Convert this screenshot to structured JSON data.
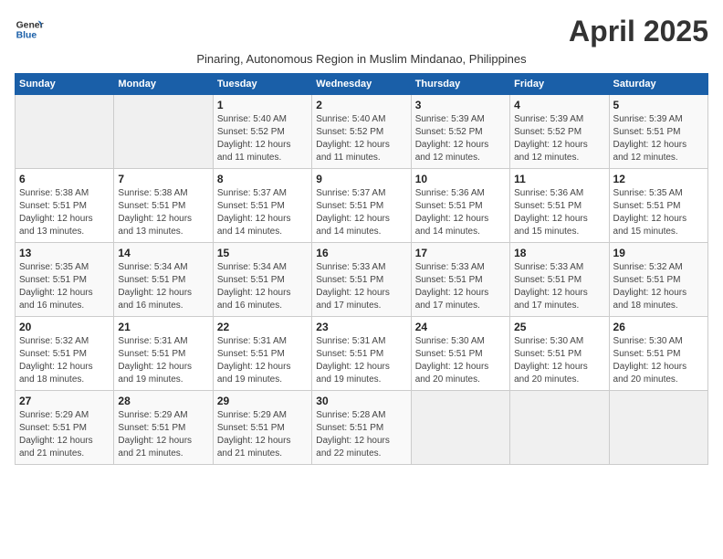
{
  "header": {
    "logo_line1": "General",
    "logo_line2": "Blue",
    "title": "April 2025",
    "subtitle": "Pinaring, Autonomous Region in Muslim Mindanao, Philippines"
  },
  "days_of_week": [
    "Sunday",
    "Monday",
    "Tuesday",
    "Wednesday",
    "Thursday",
    "Friday",
    "Saturday"
  ],
  "weeks": [
    [
      {
        "day": "",
        "info": ""
      },
      {
        "day": "",
        "info": ""
      },
      {
        "day": "1",
        "info": "Sunrise: 5:40 AM\nSunset: 5:52 PM\nDaylight: 12 hours and 11 minutes."
      },
      {
        "day": "2",
        "info": "Sunrise: 5:40 AM\nSunset: 5:52 PM\nDaylight: 12 hours and 11 minutes."
      },
      {
        "day": "3",
        "info": "Sunrise: 5:39 AM\nSunset: 5:52 PM\nDaylight: 12 hours and 12 minutes."
      },
      {
        "day": "4",
        "info": "Sunrise: 5:39 AM\nSunset: 5:52 PM\nDaylight: 12 hours and 12 minutes."
      },
      {
        "day": "5",
        "info": "Sunrise: 5:39 AM\nSunset: 5:51 PM\nDaylight: 12 hours and 12 minutes."
      }
    ],
    [
      {
        "day": "6",
        "info": "Sunrise: 5:38 AM\nSunset: 5:51 PM\nDaylight: 12 hours and 13 minutes."
      },
      {
        "day": "7",
        "info": "Sunrise: 5:38 AM\nSunset: 5:51 PM\nDaylight: 12 hours and 13 minutes."
      },
      {
        "day": "8",
        "info": "Sunrise: 5:37 AM\nSunset: 5:51 PM\nDaylight: 12 hours and 14 minutes."
      },
      {
        "day": "9",
        "info": "Sunrise: 5:37 AM\nSunset: 5:51 PM\nDaylight: 12 hours and 14 minutes."
      },
      {
        "day": "10",
        "info": "Sunrise: 5:36 AM\nSunset: 5:51 PM\nDaylight: 12 hours and 14 minutes."
      },
      {
        "day": "11",
        "info": "Sunrise: 5:36 AM\nSunset: 5:51 PM\nDaylight: 12 hours and 15 minutes."
      },
      {
        "day": "12",
        "info": "Sunrise: 5:35 AM\nSunset: 5:51 PM\nDaylight: 12 hours and 15 minutes."
      }
    ],
    [
      {
        "day": "13",
        "info": "Sunrise: 5:35 AM\nSunset: 5:51 PM\nDaylight: 12 hours and 16 minutes."
      },
      {
        "day": "14",
        "info": "Sunrise: 5:34 AM\nSunset: 5:51 PM\nDaylight: 12 hours and 16 minutes."
      },
      {
        "day": "15",
        "info": "Sunrise: 5:34 AM\nSunset: 5:51 PM\nDaylight: 12 hours and 16 minutes."
      },
      {
        "day": "16",
        "info": "Sunrise: 5:33 AM\nSunset: 5:51 PM\nDaylight: 12 hours and 17 minutes."
      },
      {
        "day": "17",
        "info": "Sunrise: 5:33 AM\nSunset: 5:51 PM\nDaylight: 12 hours and 17 minutes."
      },
      {
        "day": "18",
        "info": "Sunrise: 5:33 AM\nSunset: 5:51 PM\nDaylight: 12 hours and 17 minutes."
      },
      {
        "day": "19",
        "info": "Sunrise: 5:32 AM\nSunset: 5:51 PM\nDaylight: 12 hours and 18 minutes."
      }
    ],
    [
      {
        "day": "20",
        "info": "Sunrise: 5:32 AM\nSunset: 5:51 PM\nDaylight: 12 hours and 18 minutes."
      },
      {
        "day": "21",
        "info": "Sunrise: 5:31 AM\nSunset: 5:51 PM\nDaylight: 12 hours and 19 minutes."
      },
      {
        "day": "22",
        "info": "Sunrise: 5:31 AM\nSunset: 5:51 PM\nDaylight: 12 hours and 19 minutes."
      },
      {
        "day": "23",
        "info": "Sunrise: 5:31 AM\nSunset: 5:51 PM\nDaylight: 12 hours and 19 minutes."
      },
      {
        "day": "24",
        "info": "Sunrise: 5:30 AM\nSunset: 5:51 PM\nDaylight: 12 hours and 20 minutes."
      },
      {
        "day": "25",
        "info": "Sunrise: 5:30 AM\nSunset: 5:51 PM\nDaylight: 12 hours and 20 minutes."
      },
      {
        "day": "26",
        "info": "Sunrise: 5:30 AM\nSunset: 5:51 PM\nDaylight: 12 hours and 20 minutes."
      }
    ],
    [
      {
        "day": "27",
        "info": "Sunrise: 5:29 AM\nSunset: 5:51 PM\nDaylight: 12 hours and 21 minutes."
      },
      {
        "day": "28",
        "info": "Sunrise: 5:29 AM\nSunset: 5:51 PM\nDaylight: 12 hours and 21 minutes."
      },
      {
        "day": "29",
        "info": "Sunrise: 5:29 AM\nSunset: 5:51 PM\nDaylight: 12 hours and 21 minutes."
      },
      {
        "day": "30",
        "info": "Sunrise: 5:28 AM\nSunset: 5:51 PM\nDaylight: 12 hours and 22 minutes."
      },
      {
        "day": "",
        "info": ""
      },
      {
        "day": "",
        "info": ""
      },
      {
        "day": "",
        "info": ""
      }
    ]
  ]
}
